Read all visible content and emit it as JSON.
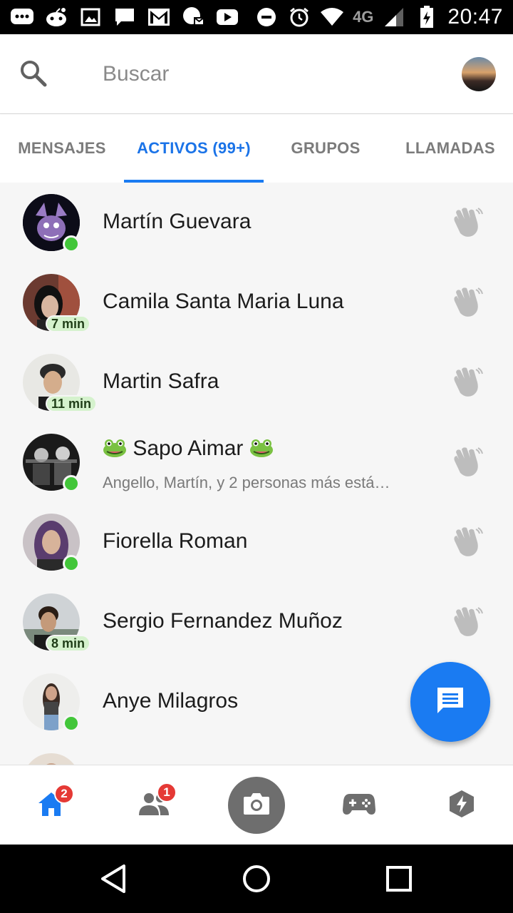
{
  "status_bar": {
    "network": "4G",
    "time": "20:47",
    "left_icons": [
      "messages-icon",
      "reddit-icon",
      "gallery-icon",
      "chat-icon",
      "gmail-icon",
      "messenger-icon",
      "youtube-icon"
    ],
    "right_icons": [
      "dnd-icon",
      "alarm-icon",
      "wifi-icon",
      "signal-icon",
      "battery-charging-icon"
    ]
  },
  "search": {
    "placeholder": "Buscar",
    "value": ""
  },
  "tabs": [
    {
      "label": "MENSAJES",
      "active": false
    },
    {
      "label": "ACTIVOS (99+)",
      "active": true
    },
    {
      "label": "GRUPOS",
      "active": false
    },
    {
      "label": "LLAMADAS",
      "active": false
    }
  ],
  "contacts": [
    {
      "name": "Martín Guevara",
      "status": "online",
      "badge": ""
    },
    {
      "name": "Camila Santa Maria Luna",
      "status": "away",
      "badge": "7 min"
    },
    {
      "name": "Martin Safra",
      "status": "away",
      "badge": "11 min"
    },
    {
      "name": "Sapo Aimar",
      "status": "online",
      "badge": "",
      "is_group": true,
      "subtitle": "Angello, Martín, y 2 personas más está…"
    },
    {
      "name": "Fiorella Roman",
      "status": "online",
      "badge": ""
    },
    {
      "name": "Sergio Fernandez Muñoz",
      "status": "away",
      "badge": "8 min"
    },
    {
      "name": "Anye Milagros",
      "status": "online",
      "badge": ""
    }
  ],
  "bottom_nav": {
    "home_badge": "2",
    "people_badge": "1"
  },
  "colors": {
    "accent": "#1a7bf2",
    "online": "#42c639",
    "badge_red": "#e53935",
    "time_badge_bg": "#d5f2cd"
  }
}
